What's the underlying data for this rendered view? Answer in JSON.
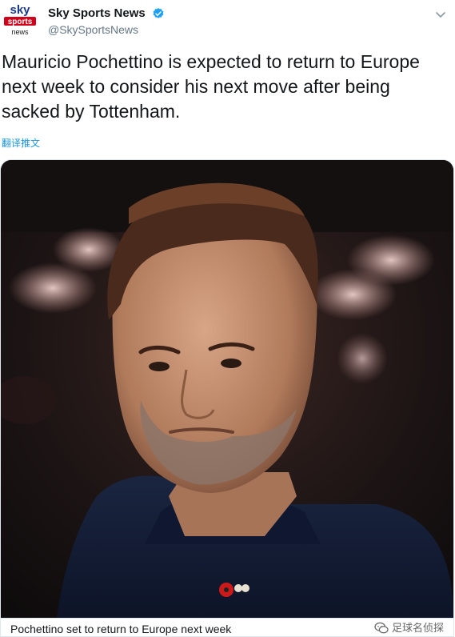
{
  "account": {
    "display_name": "Sky Sports News",
    "handle": "@SkySportsNews",
    "logo_word_top": "sky",
    "logo_word_mid": "sports",
    "logo_word_bottom": "news"
  },
  "tweet": {
    "text": "Mauricio Pochettino is expected to return to Europe next week to consider his next move after being sacked by Tottenham.",
    "translate_label": "翻译推文"
  },
  "card": {
    "title": "Pochettino set to return to Europe next week",
    "watermark": "足球名侦探"
  },
  "colors": {
    "sky_red": "#d0021b",
    "verified_blue": "#1da1f2",
    "link_blue": "#1b95e0",
    "text_gray": "#657786"
  },
  "icons": {
    "verified": "verified-badge-icon",
    "menu": "chevron-down-icon",
    "watermark": "wechat-icon"
  }
}
